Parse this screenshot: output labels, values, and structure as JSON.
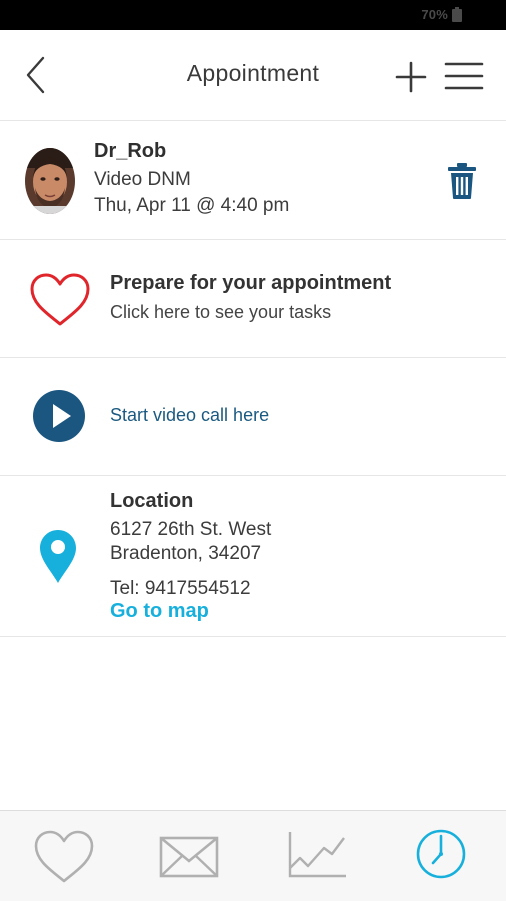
{
  "status_bar": {
    "battery_text": "70%"
  },
  "header": {
    "title": "Appointment",
    "back_icon": "chevron-left-icon",
    "add_icon": "plus-icon",
    "menu_icon": "hamburger-menu-icon"
  },
  "appointment": {
    "doctor_name": "Dr_Rob",
    "type": "Video DNM",
    "datetime": "Thu, Apr 11 @ 4:40 pm",
    "delete_icon": "trash-icon"
  },
  "prepare": {
    "title": "Prepare for your appointment",
    "subtitle": "Click here to see your tasks",
    "icon": "heart-outline-icon",
    "icon_color": "#e0252b"
  },
  "video": {
    "label": "Start video call here",
    "icon": "play-circle-icon",
    "icon_color": "#1a5680"
  },
  "location": {
    "title": "Location",
    "street": "6127 26th St. West",
    "city": "Bradenton, 34207",
    "tel": "Tel: 9417554512",
    "map_link": "Go to map",
    "icon": "map-pin-icon",
    "accent_color": "#17b0dc"
  },
  "tab_bar": {
    "tabs": [
      {
        "icon": "heart-icon",
        "active": false
      },
      {
        "icon": "envelope-icon",
        "active": false
      },
      {
        "icon": "line-chart-icon",
        "active": false
      },
      {
        "icon": "clock-icon",
        "active": true
      }
    ],
    "active_color": "#17b0dc",
    "inactive_color": "#b0b0b0"
  }
}
